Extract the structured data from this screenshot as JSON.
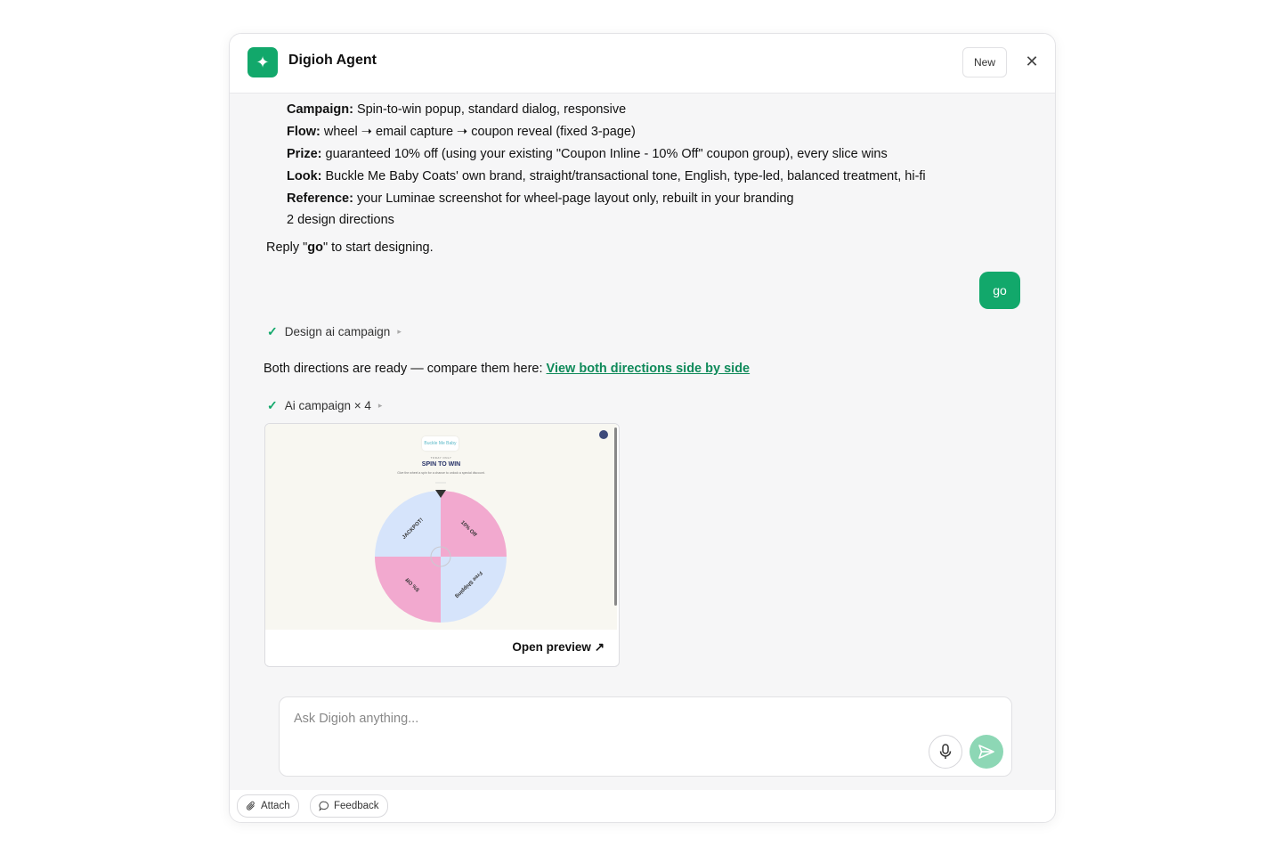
{
  "window": {
    "title": "Digioh Agent",
    "new_label": "New",
    "close_glyph": "✕",
    "logo_glyph": "✦"
  },
  "summary": [
    {
      "label": "Campaign:",
      "text": " Spin-to-win popup, standard dialog, responsive"
    },
    {
      "label": "Flow:",
      "text": " wheel ➝ email capture ➝ coupon reveal (fixed 3-page)"
    },
    {
      "label": "Prize:",
      "text": " guaranteed 10% off (using your existing \"Coupon Inline - 10% Off\" coupon group), every slice wins"
    },
    {
      "label": "Look:",
      "text": " Buckle Me Baby Coats' own brand, straight/transactional tone, English, type-led, balanced treatment, hi-fi"
    },
    {
      "label": "Reference:",
      "text": " your Luminae screenshot for wheel-page layout only, rebuilt in your branding"
    },
    {
      "label": "",
      "text": "2 design directions"
    }
  ],
  "reply": {
    "prefix": "Reply \"",
    "keyword": "go",
    "suffix": "\" to start designing."
  },
  "user_message": "go",
  "tool_calls": [
    {
      "label": "Design ai campaign"
    },
    {
      "label": "Ai campaign × 4"
    }
  ],
  "ready": {
    "text": "Both directions are ready — compare them here: ",
    "link": "View both directions side by side"
  },
  "preview": {
    "brand": "Buckle Me Baby",
    "eyebrow": "TODAY ONLY",
    "title": "SPIN TO WIN",
    "subtitle": "Give the wheel a spin for a chance to unlock a special discount.",
    "slices": [
      "JACKPOT!",
      "10% Off",
      "Free Shipping",
      "5% Off"
    ],
    "slice_colors": [
      "#d6e4fb",
      "#f2a9cf",
      "#d6e4fb",
      "#f2a9cf"
    ],
    "open_label": "Open preview",
    "open_icon": "↗"
  },
  "composer": {
    "placeholder": "Ask Digioh anything..."
  },
  "footer": {
    "attach_label": "Attach",
    "feedback_label": "Feedback"
  },
  "colors": {
    "accent": "#12a86b",
    "link": "#0f8a5a",
    "send_disabled": "#8dd7b5"
  }
}
